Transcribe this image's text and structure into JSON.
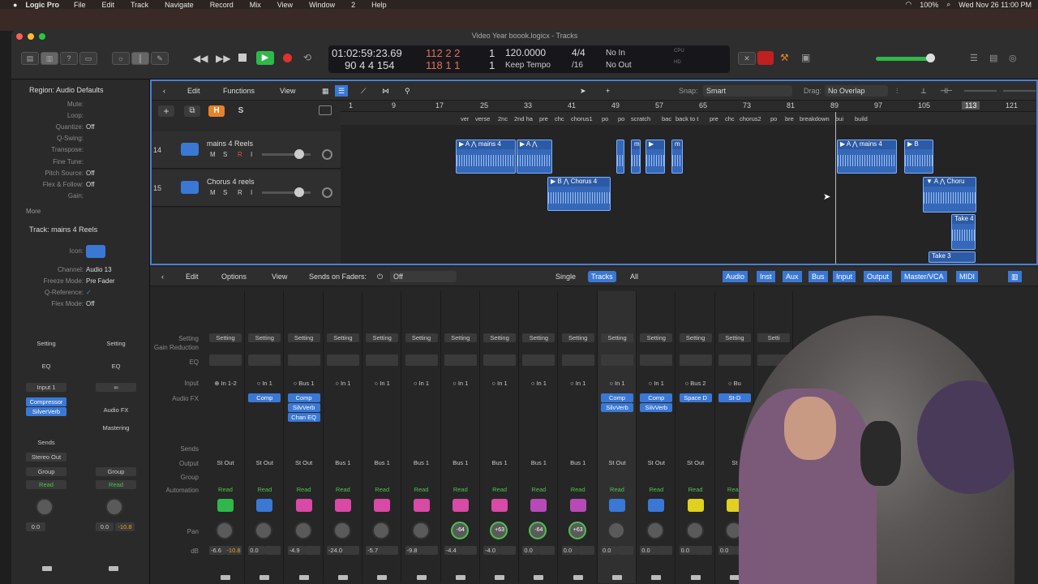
{
  "menubar": {
    "app": "Logic Pro",
    "items": [
      "File",
      "Edit",
      "Track",
      "Navigate",
      "Record",
      "Mix",
      "View",
      "Window",
      "2",
      "Help"
    ],
    "battery": "100%",
    "datetime": "Wed Nov 26  11:00 PM"
  },
  "window": {
    "title": "Video Year boook.logicx - Tracks"
  },
  "lcd": {
    "time": "01:02:59:23.69",
    "bars_top": "112  2  2",
    "beat_top": "1",
    "bars_bottom": "90  4  4  154",
    "bars_bottom2": "118  1  1",
    "beat_bottom": "1",
    "tempo": "120.0000",
    "tempo_mode": "Keep Tempo",
    "sig": "4/4",
    "div": "/16",
    "in": "No In",
    "out": "No Out",
    "cpu": "CPU",
    "hd": "HD"
  },
  "tracks_toolbar": {
    "edit": "Edit",
    "functions": "Functions",
    "view": "View",
    "snap_label": "Snap:",
    "snap_value": "Smart",
    "drag_label": "Drag:",
    "drag_value": "No Overlap"
  },
  "ruler": {
    "bars": [
      "1",
      "9",
      "17",
      "25",
      "33",
      "41",
      "49",
      "57",
      "65",
      "73",
      "81",
      "89",
      "97",
      "105",
      "113",
      "121"
    ]
  },
  "markers": [
    "ver",
    "verse",
    "2nc",
    "2nd ha",
    "pre",
    "chc",
    "chorus1",
    "po",
    "po",
    "scratch",
    "bac",
    "back to t",
    "pre",
    "chc",
    "chorus2",
    "po",
    "bre",
    "breakdown",
    "bui",
    "build"
  ],
  "track_buttons": {
    "add": "+",
    "h": "H",
    "s": "S"
  },
  "tracks": [
    {
      "num": "14",
      "name": "mains 4 Reels"
    },
    {
      "num": "15",
      "name": "Chorus 4 reels"
    }
  ],
  "mute_solo": [
    "M",
    "S",
    "R",
    "I"
  ],
  "regions": [
    {
      "label": "▶ A ⋀ mains 4"
    },
    {
      "label": "▶ A ⋀"
    },
    {
      "label": "▶ B ⋀ Chorus 4"
    },
    {
      "label": "▶"
    },
    {
      "label": "m"
    },
    {
      "label": "▶ A ⋀ mains 4"
    },
    {
      "label": "▶ B"
    },
    {
      "label": "▼ A ⋀ Choru"
    },
    {
      "label": "Take 4"
    },
    {
      "label": "Take 3"
    }
  ],
  "inspector": {
    "region_title": "Region: Audio Defaults",
    "rows": [
      {
        "k": "Mute:",
        "v": ""
      },
      {
        "k": "Loop:",
        "v": ""
      },
      {
        "k": "Quantize:",
        "v": "Off"
      },
      {
        "k": "Q-Swing:",
        "v": ""
      },
      {
        "k": "Transpose:",
        "v": ""
      },
      {
        "k": "Fine Tune:",
        "v": ""
      },
      {
        "k": "Pitch Source:",
        "v": "Off"
      },
      {
        "k": "Flex & Follow:",
        "v": "Off"
      },
      {
        "k": "Gain:",
        "v": ""
      }
    ],
    "more": "More",
    "track_title": "Track:  mains 4 Reels",
    "track_rows": [
      {
        "k": "Icon:",
        "v": ""
      },
      {
        "k": "Channel:",
        "v": "Audio 13"
      },
      {
        "k": "Freeze Mode:",
        "v": "Pre Fader"
      },
      {
        "k": "Q-Reference:",
        "v": "✓"
      },
      {
        "k": "Flex Mode:",
        "v": "Off"
      }
    ],
    "strip1": {
      "setting": "Setting",
      "eq": "EQ",
      "input": "Input 1",
      "fx1": "Compressor",
      "fx2": "SilverVerb",
      "sends": "Sends",
      "out": "Stereo Out",
      "group": "Group",
      "read": "Read",
      "db1": "0.0"
    },
    "strip2": {
      "setting": "Setting",
      "eq": "EQ",
      "input": "∞",
      "fx": "Audio FX",
      "mastering": "Mastering",
      "group": "Group",
      "read": "Read",
      "db1": "0.0",
      "db2": "-10.8"
    }
  },
  "mixer_toolbar": {
    "edit": "Edit",
    "options": "Options",
    "view": "View",
    "sends_label": "Sends on Faders:",
    "sends_value": "Off",
    "single": "Single",
    "tracks": "Tracks",
    "all": "All",
    "filters": [
      "Audio",
      "Inst",
      "Aux",
      "Bus",
      "Input",
      "Output",
      "Master/VCA",
      "MIDI"
    ]
  },
  "mixer_labels": {
    "setting": "Setting",
    "gain": "Gain Reduction",
    "eq": "EQ",
    "input": "Input",
    "audiofx": "Audio FX",
    "sends": "Sends",
    "output": "Output",
    "group": "Group",
    "automation": "Automation",
    "pan": "Pan",
    "db": "dB"
  },
  "strips": [
    {
      "setting": "Setting",
      "input": "⊕ In 1-2",
      "fx": [],
      "out": "St Out",
      "auto": "Read",
      "pan": "",
      "db1": "-6.6",
      "db2": "-10.8",
      "icon": "#2fb84a"
    },
    {
      "setting": "Setting",
      "input": "○ In 1",
      "fx": [
        "Comp"
      ],
      "out": "St Out",
      "auto": "Read",
      "pan": "",
      "db1": "0.0",
      "db2": "",
      "icon": "#3a78d6"
    },
    {
      "setting": "Setting",
      "input": "○ Bus 1",
      "fx": [
        "Comp",
        "SilvVerb",
        "Chan EQ"
      ],
      "out": "St Out",
      "auto": "Read",
      "pan": "",
      "db1": "-4.9",
      "db2": "",
      "icon": "#d84aa6"
    },
    {
      "setting": "Setting",
      "input": "○ In 1",
      "fx": [],
      "out": "Bus 1",
      "auto": "Read",
      "pan": "",
      "db1": "-24.0",
      "db2": "",
      "icon": "#d84aa6"
    },
    {
      "setting": "Setting",
      "input": "○ In 1",
      "fx": [],
      "out": "Bus 1",
      "auto": "Read",
      "pan": "",
      "db1": "-5.7",
      "db2": "",
      "icon": "#d84aa6"
    },
    {
      "setting": "Setting",
      "input": "○ In 1",
      "fx": [],
      "out": "Bus 1",
      "auto": "Read",
      "pan": "",
      "db1": "-9.8",
      "db2": "",
      "icon": "#d84aa6"
    },
    {
      "setting": "Setting",
      "input": "○ In 1",
      "fx": [],
      "out": "Bus 1",
      "auto": "Read",
      "pan": "-64",
      "db1": "-4.4",
      "db2": "",
      "icon": "#d84aa6"
    },
    {
      "setting": "Setting",
      "input": "○ In 1",
      "fx": [],
      "out": "Bus 1",
      "auto": "Read",
      "pan": "+63",
      "db1": "-4.0",
      "db2": "",
      "icon": "#d84aa6"
    },
    {
      "setting": "Setting",
      "input": "○ In 1",
      "fx": [],
      "out": "Bus 1",
      "auto": "Read",
      "pan": "-64",
      "db1": "0.0",
      "db2": "",
      "icon": "#b84ab8"
    },
    {
      "setting": "Setting",
      "input": "○ In 1",
      "fx": [],
      "out": "Bus 1",
      "auto": "Read",
      "pan": "+63",
      "db1": "0.0",
      "db2": "",
      "icon": "#b84ab8"
    },
    {
      "setting": "Setting",
      "input": "○ In 1",
      "fx": [
        "Comp",
        "SilvVerb"
      ],
      "out": "St Out",
      "auto": "Read",
      "pan": "",
      "db1": "0.0",
      "db2": "",
      "icon": "#3a78d6"
    },
    {
      "setting": "Setting",
      "input": "○ In 1",
      "fx": [
        "Comp",
        "SilvVerb"
      ],
      "out": "St Out",
      "auto": "Read",
      "pan": "",
      "db1": "0.0",
      "db2": "",
      "icon": "#3a78d6"
    },
    {
      "setting": "Setting",
      "input": "○ Bus 2",
      "fx": [
        "Space D"
      ],
      "out": "St Out",
      "auto": "Read",
      "pan": "",
      "db1": "0.0",
      "db2": "",
      "icon": "#e0d020"
    },
    {
      "setting": "Setting",
      "input": "○ Bu",
      "fx": [
        "St-D"
      ],
      "out": "St",
      "auto": "Read",
      "pan": "",
      "db1": "0.0",
      "db2": "",
      "icon": "#e0d020"
    },
    {
      "setting": "Setti",
      "input": "",
      "fx": [],
      "out": "",
      "auto": "",
      "pan": "",
      "db1": "",
      "db2": "",
      "icon": "#3a3a3a"
    }
  ],
  "colors": {
    "accent": "#3a78d6",
    "play": "#2fb84a",
    "record": "#e03030",
    "solo": "#e8822a"
  }
}
